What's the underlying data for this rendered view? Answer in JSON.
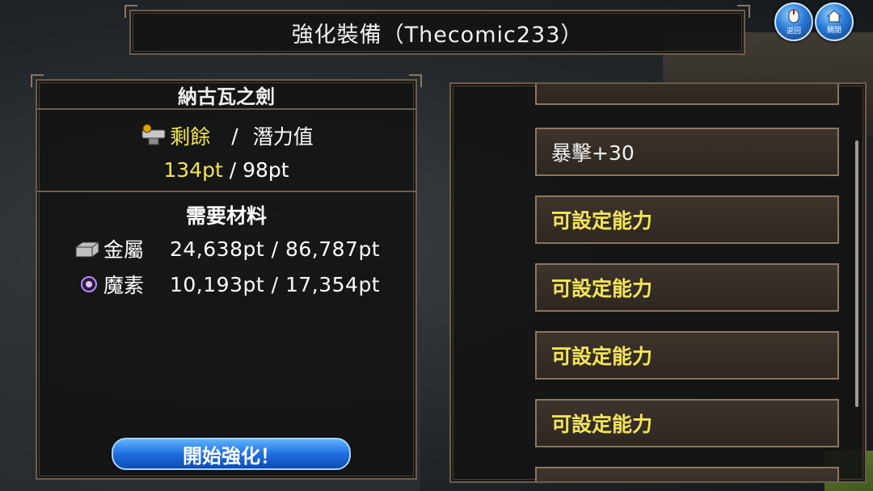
{
  "header": {
    "title": "強化裝備（Thecomic233）"
  },
  "top_buttons": [
    {
      "label": "返回",
      "icon": "mouse-icon"
    },
    {
      "label": "關閉",
      "icon": "home-icon"
    }
  ],
  "left_panel": {
    "item_name": "納古瓦之劍",
    "remaining_label": "剩餘",
    "separator": "/",
    "potential_label": "潛力值",
    "values": "134pt / 98pt",
    "remaining_value": "134pt",
    "potential_value": "98pt",
    "materials_title": "需要材料",
    "materials": [
      {
        "name": "金屬",
        "value": "24,638pt / 86,787pt",
        "icon": "metal-icon"
      },
      {
        "name": "魔素",
        "value": "10,193pt / 17,354pt",
        "icon": "mana-icon"
      }
    ],
    "start_button": "開始強化！"
  },
  "right_panel": {
    "slots": [
      {
        "text": "暴擊+30",
        "style": "white"
      },
      {
        "text": "可設定能力",
        "style": "yellow"
      },
      {
        "text": "可設定能力",
        "style": "yellow"
      },
      {
        "text": "可設定能力",
        "style": "yellow"
      },
      {
        "text": "可設定能力",
        "style": "yellow"
      }
    ]
  },
  "colors": {
    "accent_yellow": "#f3e45a",
    "frame": "#6b5d4d",
    "button_blue": "#1f6fe0"
  }
}
